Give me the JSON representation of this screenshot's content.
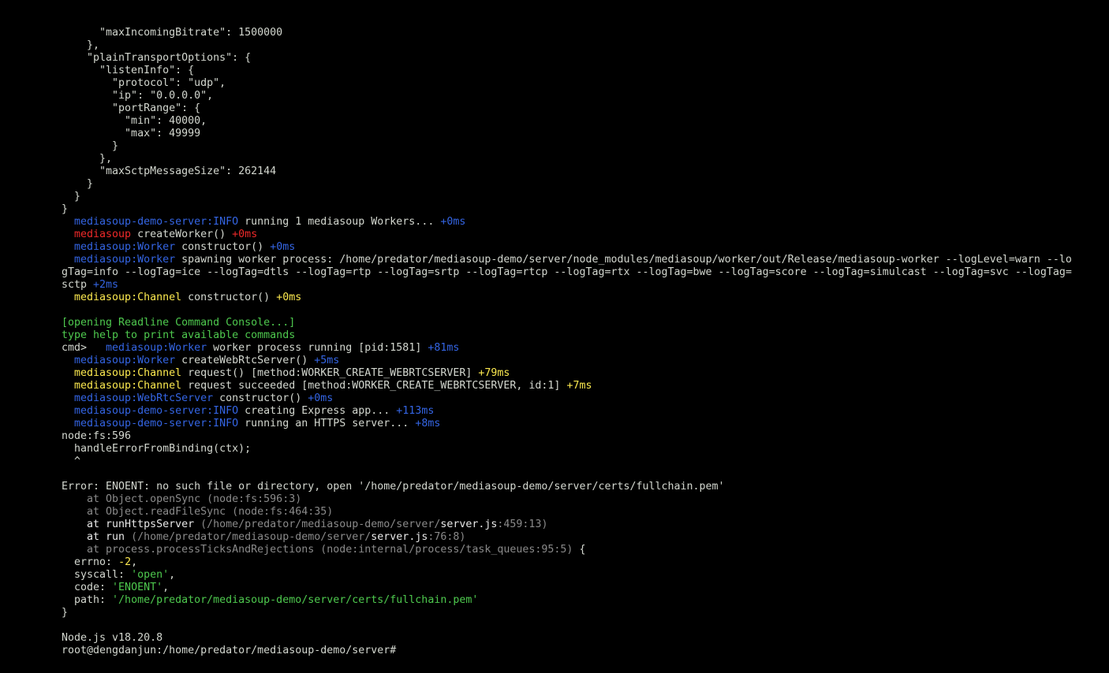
{
  "terminal": {
    "lines": [
      [
        {
          "t": "      \"maxIncomingBitrate\": 1500000",
          "c": ""
        }
      ],
      [
        {
          "t": "    },",
          "c": ""
        }
      ],
      [
        {
          "t": "    \"plainTransportOptions\": {",
          "c": ""
        }
      ],
      [
        {
          "t": "      \"listenInfo\": {",
          "c": ""
        }
      ],
      [
        {
          "t": "        \"protocol\": \"udp\",",
          "c": ""
        }
      ],
      [
        {
          "t": "        \"ip\": \"0.0.0.0\",",
          "c": ""
        }
      ],
      [
        {
          "t": "        \"portRange\": {",
          "c": ""
        }
      ],
      [
        {
          "t": "          \"min\": 40000,",
          "c": ""
        }
      ],
      [
        {
          "t": "          \"max\": 49999",
          "c": ""
        }
      ],
      [
        {
          "t": "        }",
          "c": ""
        }
      ],
      [
        {
          "t": "      },",
          "c": ""
        }
      ],
      [
        {
          "t": "      \"maxSctpMessageSize\": 262144",
          "c": ""
        }
      ],
      [
        {
          "t": "    }",
          "c": ""
        }
      ],
      [
        {
          "t": "  }",
          "c": ""
        }
      ],
      [
        {
          "t": "}",
          "c": ""
        }
      ],
      [
        {
          "t": "  ",
          "c": ""
        },
        {
          "t": "mediasoup-demo-server:INFO",
          "c": "blue"
        },
        {
          "t": " running 1 mediasoup Workers... ",
          "c": ""
        },
        {
          "t": "+0ms",
          "c": "blue"
        }
      ],
      [
        {
          "t": "  ",
          "c": ""
        },
        {
          "t": "mediasoup",
          "c": "red"
        },
        {
          "t": " createWorker() ",
          "c": ""
        },
        {
          "t": "+0ms",
          "c": "red"
        }
      ],
      [
        {
          "t": "  ",
          "c": ""
        },
        {
          "t": "mediasoup:Worker",
          "c": "blue"
        },
        {
          "t": " constructor() ",
          "c": ""
        },
        {
          "t": "+0ms",
          "c": "blue"
        }
      ],
      [
        {
          "t": "  ",
          "c": ""
        },
        {
          "t": "mediasoup:Worker",
          "c": "blue"
        },
        {
          "t": " spawning worker process: /home/predator/mediasoup-demo/server/node_modules/mediasoup/worker/out/Release/mediasoup-worker --logLevel=warn --lo",
          "c": ""
        }
      ],
      [
        {
          "t": "gTag=info --logTag=ice --logTag=dtls --logTag=rtp --logTag=srtp --logTag=rtcp --logTag=rtx --logTag=bwe --logTag=score --logTag=simulcast --logTag=svc --logTag=",
          "c": ""
        }
      ],
      [
        {
          "t": "sctp ",
          "c": ""
        },
        {
          "t": "+2ms",
          "c": "blue"
        }
      ],
      [
        {
          "t": "  ",
          "c": ""
        },
        {
          "t": "mediasoup:Channel",
          "c": "yellow"
        },
        {
          "t": " constructor() ",
          "c": ""
        },
        {
          "t": "+0ms",
          "c": "yellow"
        }
      ],
      [
        {
          "t": "",
          "c": ""
        }
      ],
      [
        {
          "t": "[opening Readline Command Console...]",
          "c": "green"
        }
      ],
      [
        {
          "t": "type help to print available commands",
          "c": "green"
        }
      ],
      [
        {
          "t": "cmd>   ",
          "c": ""
        },
        {
          "t": "mediasoup:Worker",
          "c": "blue"
        },
        {
          "t": " worker process running [pid:1581] ",
          "c": ""
        },
        {
          "t": "+81ms",
          "c": "blue"
        }
      ],
      [
        {
          "t": "  ",
          "c": ""
        },
        {
          "t": "mediasoup:Worker",
          "c": "blue"
        },
        {
          "t": " createWebRtcServer() ",
          "c": ""
        },
        {
          "t": "+5ms",
          "c": "blue"
        }
      ],
      [
        {
          "t": "  ",
          "c": ""
        },
        {
          "t": "mediasoup:Channel",
          "c": "yellow"
        },
        {
          "t": " request() [method:WORKER_CREATE_WEBRTCSERVER] ",
          "c": ""
        },
        {
          "t": "+79ms",
          "c": "yellow"
        }
      ],
      [
        {
          "t": "  ",
          "c": ""
        },
        {
          "t": "mediasoup:Channel",
          "c": "yellow"
        },
        {
          "t": " request succeeded [method:WORKER_CREATE_WEBRTCSERVER, id:1] ",
          "c": ""
        },
        {
          "t": "+7ms",
          "c": "yellow"
        }
      ],
      [
        {
          "t": "  ",
          "c": ""
        },
        {
          "t": "mediasoup:WebRtcServer",
          "c": "blue"
        },
        {
          "t": " constructor() ",
          "c": ""
        },
        {
          "t": "+0ms",
          "c": "blue"
        }
      ],
      [
        {
          "t": "  ",
          "c": ""
        },
        {
          "t": "mediasoup-demo-server:INFO",
          "c": "blue"
        },
        {
          "t": " creating Express app... ",
          "c": ""
        },
        {
          "t": "+113ms",
          "c": "blue"
        }
      ],
      [
        {
          "t": "  ",
          "c": ""
        },
        {
          "t": "mediasoup-demo-server:INFO",
          "c": "blue"
        },
        {
          "t": " running an HTTPS server... ",
          "c": ""
        },
        {
          "t": "+8ms",
          "c": "blue"
        }
      ],
      [
        {
          "t": "node:fs:596",
          "c": ""
        }
      ],
      [
        {
          "t": "  handleErrorFromBinding(ctx);",
          "c": ""
        }
      ],
      [
        {
          "t": "  ^",
          "c": ""
        }
      ],
      [
        {
          "t": "",
          "c": ""
        }
      ],
      [
        {
          "t": "Error: ENOENT: no such file or directory, open '/home/predator/mediasoup-demo/server/certs/fullchain.pem'",
          "c": ""
        }
      ],
      [
        {
          "t": "    at Object.openSync (node:fs:596:3)",
          "c": "dim"
        }
      ],
      [
        {
          "t": "    at Object.readFileSync (node:fs:464:35)",
          "c": "dim"
        }
      ],
      [
        {
          "t": "    at runHttpsServer ",
          "c": "white"
        },
        {
          "t": "(/home/predator/mediasoup-demo/server/",
          "c": "dim"
        },
        {
          "t": "server.js",
          "c": "white"
        },
        {
          "t": ":459:13)",
          "c": "dim"
        }
      ],
      [
        {
          "t": "    at run ",
          "c": "white"
        },
        {
          "t": "(/home/predator/mediasoup-demo/server/",
          "c": "dim"
        },
        {
          "t": "server.js",
          "c": "white"
        },
        {
          "t": ":76:8)",
          "c": "dim"
        }
      ],
      [
        {
          "t": "    at process.processTicksAndRejections (node:internal/process/task_queues:95:5)",
          "c": "dim"
        },
        {
          "t": " {",
          "c": ""
        }
      ],
      [
        {
          "t": "  errno: ",
          "c": ""
        },
        {
          "t": "-2",
          "c": "yellow"
        },
        {
          "t": ",",
          "c": ""
        }
      ],
      [
        {
          "t": "  syscall: ",
          "c": ""
        },
        {
          "t": "'open'",
          "c": "green"
        },
        {
          "t": ",",
          "c": ""
        }
      ],
      [
        {
          "t": "  code: ",
          "c": ""
        },
        {
          "t": "'ENOENT'",
          "c": "green"
        },
        {
          "t": ",",
          "c": ""
        }
      ],
      [
        {
          "t": "  path: ",
          "c": ""
        },
        {
          "t": "'/home/predator/mediasoup-demo/server/certs/fullchain.pem'",
          "c": "green"
        }
      ],
      [
        {
          "t": "}",
          "c": ""
        }
      ],
      [
        {
          "t": "",
          "c": ""
        }
      ],
      [
        {
          "t": "Node.js v18.20.8",
          "c": ""
        }
      ],
      [
        {
          "t": "root@dengdanjun:/home/predator/mediasoup-demo/server# ",
          "c": ""
        }
      ]
    ]
  }
}
